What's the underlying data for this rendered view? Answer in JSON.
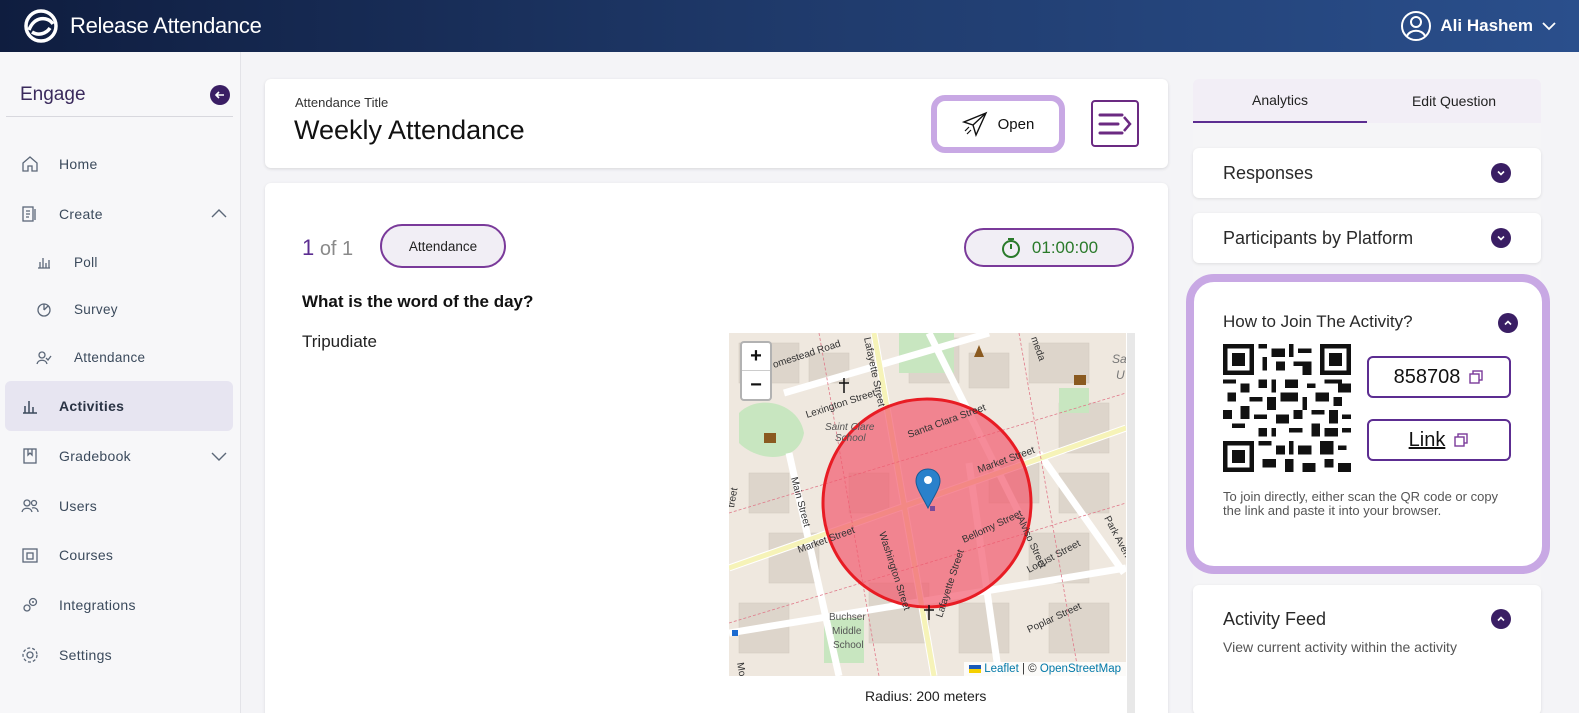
{
  "app": {
    "title": "Release Attendance",
    "user_name": "Ali Hashem"
  },
  "sidebar": {
    "title": "Engage",
    "items": [
      {
        "label": "Home",
        "icon": "home-icon"
      },
      {
        "label": "Create",
        "icon": "create-icon",
        "expanded": true
      },
      {
        "label": "Poll",
        "icon": "poll-icon",
        "sub": true
      },
      {
        "label": "Survey",
        "icon": "survey-icon",
        "sub": true
      },
      {
        "label": "Attendance",
        "icon": "attendance-icon",
        "sub": true
      },
      {
        "label": "Activities",
        "icon": "activities-icon",
        "active": true
      },
      {
        "label": "Gradebook",
        "icon": "gradebook-icon",
        "expanded": false
      },
      {
        "label": "Users",
        "icon": "users-icon"
      },
      {
        "label": "Courses",
        "icon": "courses-icon"
      },
      {
        "label": "Integrations",
        "icon": "integrations-icon"
      },
      {
        "label": "Settings",
        "icon": "settings-icon"
      }
    ]
  },
  "header": {
    "title_label": "Attendance Title",
    "title_value": "Weekly Attendance",
    "open_label": "Open"
  },
  "question": {
    "index": "1",
    "of_text": "of 1",
    "type": "Attendance",
    "timer": "01:00:00",
    "text": "What is the word of the day?",
    "answer": "Tripudiate",
    "radius_text": "Radius:  200 meters"
  },
  "map": {
    "zoom_in": "+",
    "zoom_out": "−",
    "attribution_leaflet": "Leaflet",
    "attribution_sep": " | © ",
    "attribution_osm": "OpenStreetMap",
    "labels": {
      "homestead": "omestead Road",
      "lexington": "Lexington Street",
      "lafayette_top": "Lafayette Street",
      "santa_clara": "Santa Clara Street",
      "market_right": "Market Street",
      "market_left": "Market Street",
      "saint_clare": "Saint Clare",
      "school": "School",
      "main": "Main Street",
      "washington": "Washington Street",
      "bellomy": "Bellomy Street",
      "lafayette_bottom": "Lafayette Street",
      "alviso": "Alviso Street",
      "locust": "Locust Street",
      "park": "Park Avenue",
      "poplar": "Poplar Street",
      "buchser": "Buchser",
      "middle": "Middle",
      "school2": "School",
      "sa": "Sa",
      "u": "U",
      "meda": "meda",
      "treet": "treet",
      "mo": "Mo"
    },
    "colors": {
      "radius_fill": "#f25a6e",
      "radius_stroke": "#e81c24",
      "marker": "#2a81cb"
    }
  },
  "right": {
    "tabs": [
      "Analytics",
      "Edit Question"
    ],
    "responses_title": "Responses",
    "platform_title": "Participants by Platform",
    "join_title": "How to Join The Activity?",
    "join_code": "858708",
    "join_link_label": "Link",
    "join_help": "To join directly, either scan the QR code or copy the link and paste it into your browser.",
    "feed_title": "Activity Feed",
    "feed_sub": "View current activity within the activity"
  },
  "colors": {
    "accent": "#5c2d91",
    "highlight": "#c8a8e4",
    "timer_text": "#2a7a2a"
  }
}
